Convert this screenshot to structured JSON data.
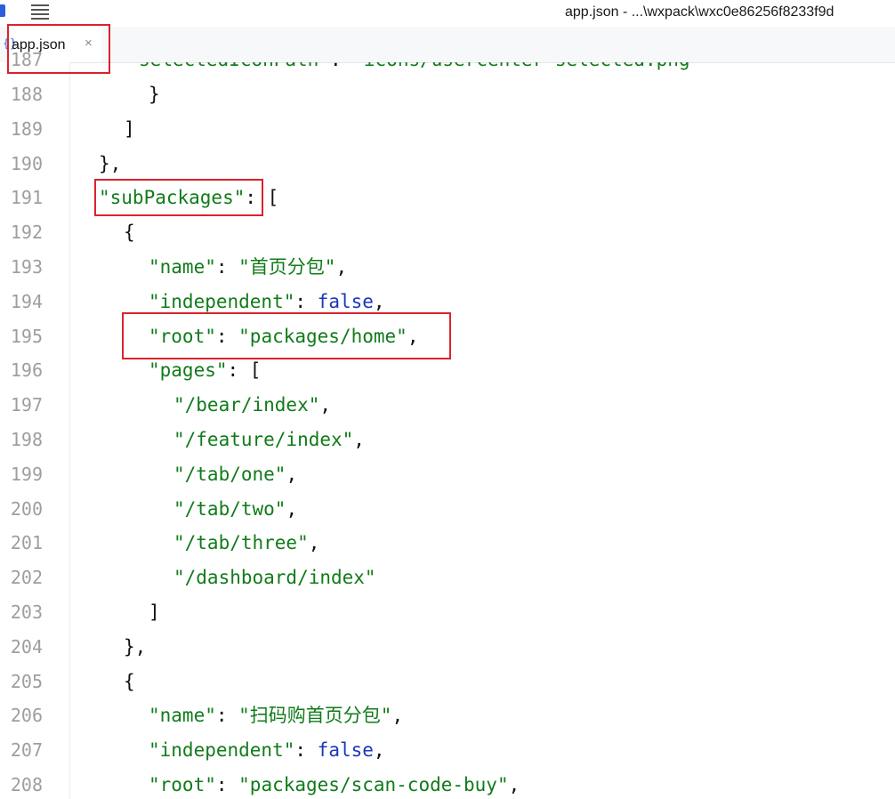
{
  "window": {
    "title": "app.json - ...\\wxpack\\wxc0e86256f8233f9d",
    "menu_icon": "hamburger-menu-icon",
    "logo_icon": "app-logo-icon"
  },
  "tab": {
    "label": "app.json",
    "close": "×",
    "file_icon": "{}"
  },
  "editor": {
    "partial_top_line": "  \"selectedIconPath\": \"icons/usercenter-selected.png\"",
    "lines": [
      {
        "num": "188",
        "text": "    }"
      },
      {
        "num": "189",
        "text": "  ]"
      },
      {
        "num": "190",
        "text": "},"
      },
      {
        "num": "191",
        "text": "\"subPackages\": ["
      },
      {
        "num": "192",
        "text": "  {"
      },
      {
        "num": "193",
        "text": "    \"name\": \"首页分包\","
      },
      {
        "num": "194",
        "text": "    \"independent\": false,"
      },
      {
        "num": "195",
        "text": "    \"root\": \"packages/home\","
      },
      {
        "num": "196",
        "text": "    \"pages\": ["
      },
      {
        "num": "197",
        "text": "      \"/bear/index\","
      },
      {
        "num": "198",
        "text": "      \"/feature/index\","
      },
      {
        "num": "199",
        "text": "      \"/tab/one\","
      },
      {
        "num": "200",
        "text": "      \"/tab/two\","
      },
      {
        "num": "201",
        "text": "      \"/tab/three\","
      },
      {
        "num": "202",
        "text": "      \"/dashboard/index\""
      },
      {
        "num": "203",
        "text": "    ]"
      },
      {
        "num": "204",
        "text": "  },"
      },
      {
        "num": "205",
        "text": "  {"
      },
      {
        "num": "206",
        "text": "    \"name\": \"扫码购首页分包\","
      },
      {
        "num": "207",
        "text": "    \"independent\": false,"
      },
      {
        "num": "208",
        "text": "    \"root\": \"packages/scan-code-buy\","
      }
    ]
  },
  "colors": {
    "string": "#117b1a",
    "keyword": "#1a38b8",
    "highlight": "#d9232d",
    "line_number": "#9e9e9e"
  }
}
